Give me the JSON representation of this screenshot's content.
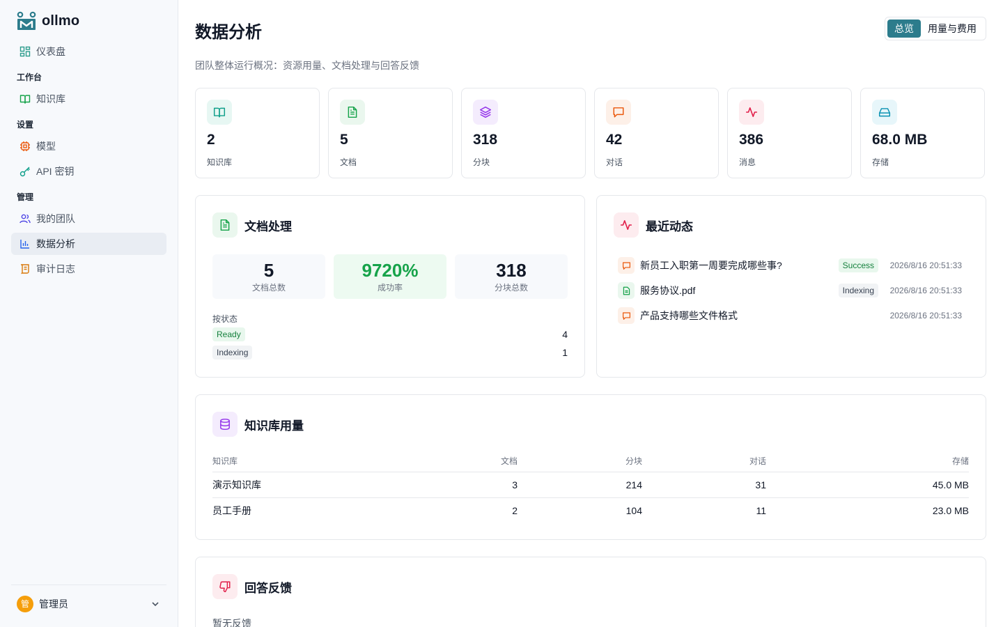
{
  "app": {
    "name": "ollmo"
  },
  "sidebar": {
    "dashboard": "仪表盘",
    "section_workspace": "工作台",
    "knowledge_base": "知识库",
    "section_settings": "设置",
    "model": "模型",
    "api_keys": "API 密钥",
    "section_admin": "管理",
    "my_team": "我的团队",
    "analytics": "数据分析",
    "audit_log": "审计日志",
    "user": {
      "avatar": "管",
      "name": "管理员"
    }
  },
  "header": {
    "title": "数据分析",
    "subtitle": "团队整体运行概况：资源用量、文档处理与回答反馈",
    "tabs": [
      "总览",
      "用量与费用"
    ]
  },
  "stats": [
    {
      "value": "2",
      "label": "知识库",
      "icon": "book-icon",
      "color": "#0f9f8a",
      "bg": "#e7f7f3"
    },
    {
      "value": "5",
      "label": "文档",
      "icon": "file-text-icon",
      "color": "#16a34a",
      "bg": "#eaf7ee"
    },
    {
      "value": "318",
      "label": "分块",
      "icon": "layers-icon",
      "color": "#9333ea",
      "bg": "#f4ecfd"
    },
    {
      "value": "42",
      "label": "对话",
      "icon": "message-icon",
      "color": "#ea580c",
      "bg": "#fdf0e8"
    },
    {
      "value": "386",
      "label": "消息",
      "icon": "activity-icon",
      "color": "#e11d48",
      "bg": "#fdecef"
    },
    {
      "value": "68.0 MB",
      "label": "存储",
      "icon": "hard-drive-icon",
      "color": "#0891b2",
      "bg": "#e7f6fa"
    }
  ],
  "doc_processing": {
    "title": "文档处理",
    "total": {
      "value": "5",
      "label": "文档总数"
    },
    "success": {
      "value": "9720%",
      "label": "成功率"
    },
    "chunks": {
      "value": "318",
      "label": "分块总数"
    },
    "by_status_label": "按状态",
    "statuses": [
      {
        "name": "Ready",
        "count": "4"
      },
      {
        "name": "Indexing",
        "count": "1"
      }
    ]
  },
  "recent_activity": {
    "title": "最近动态",
    "items": [
      {
        "title": "新员工入职第一周要完成哪些事?",
        "badge": "Success",
        "time": "2026/8/16 20:51:33",
        "kind": "message"
      },
      {
        "title": "服务协议.pdf",
        "badge": "Indexing",
        "time": "2026/8/16 20:51:33",
        "kind": "file"
      },
      {
        "title": "产品支持哪些文件格式",
        "badge": "",
        "time": "2026/8/16 20:51:33",
        "kind": "message"
      }
    ]
  },
  "kb_usage": {
    "title": "知识库用量",
    "columns": [
      "知识库",
      "文档",
      "分块",
      "对话",
      "存储"
    ],
    "rows": [
      [
        "演示知识库",
        "3",
        "214",
        "31",
        "45.0 MB"
      ],
      [
        "员工手册",
        "2",
        "104",
        "11",
        "23.0 MB"
      ]
    ]
  },
  "feedback": {
    "title": "回答反馈",
    "empty": "暂无反馈"
  }
}
